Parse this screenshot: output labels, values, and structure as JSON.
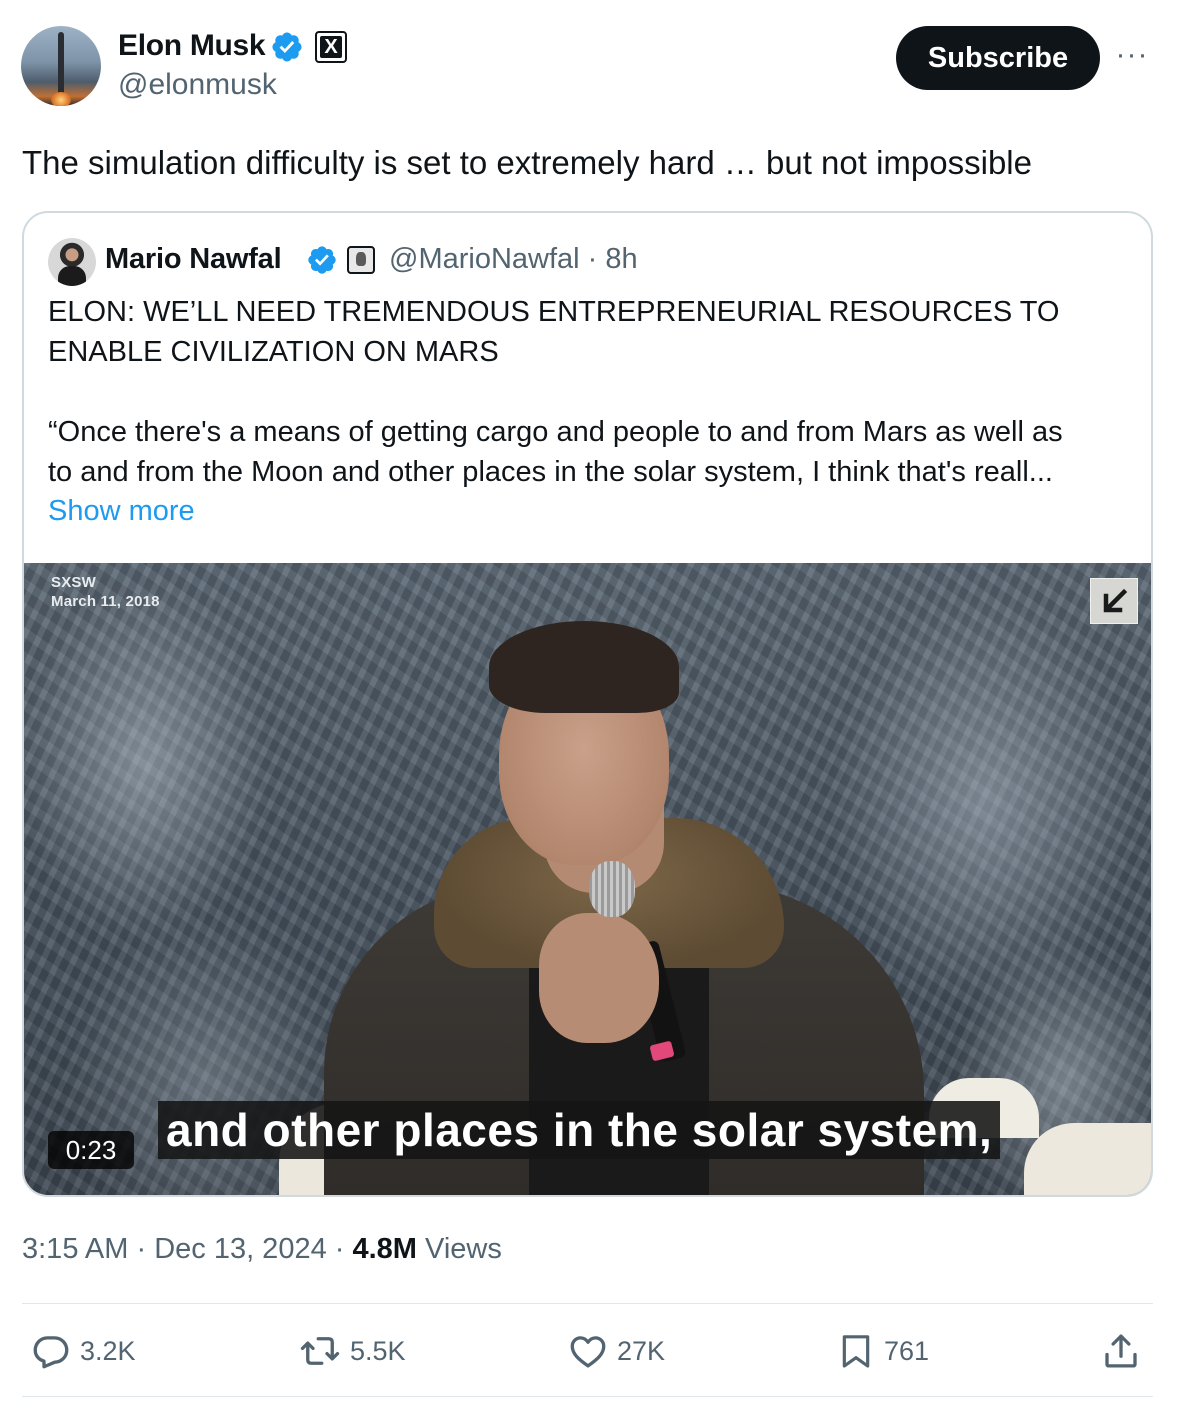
{
  "author": {
    "name": "Elon Musk",
    "handle": "@elonmusk",
    "affiliate_badge": "X"
  },
  "header": {
    "subscribe_label": "Subscribe",
    "more_label": "···"
  },
  "tweet": {
    "text": "The simulation difficulty is set to extremely hard … but not impossible"
  },
  "quote": {
    "name": "Mario Nawfal",
    "handle_time": "@MarioNawfal · 8h",
    "line1": "ELON: WE’LL NEED TREMENDOUS ENTREPRENEURIAL RESOURCES TO",
    "line2": "ENABLE CIVILIZATION ON MARS",
    "line3": "“Once there's a means of getting cargo and people to and from Mars as well as",
    "line4": "to and from the Moon and other places in the solar system, I think that's reall...",
    "show_more": "Show more",
    "video": {
      "event": "SXSW",
      "date": "March 11, 2018",
      "caption": "and other places in the solar system,",
      "duration": "0:23"
    }
  },
  "meta": {
    "time": "3:15 AM",
    "date": "Dec 13, 2024",
    "views_count": "4.8M",
    "views_label": "Views"
  },
  "actions": {
    "replies": "3.2K",
    "reposts": "5.5K",
    "likes": "27K",
    "bookmarks": "761"
  },
  "colors": {
    "accent": "#1d9bf0",
    "text": "#0f1419",
    "muted": "#536471",
    "border": "#cfd9de"
  },
  "icons": [
    "verified-badge-icon",
    "x-logo-icon",
    "more-icon",
    "expand-icon",
    "reply-icon",
    "repost-icon",
    "like-icon",
    "bookmark-icon",
    "share-icon"
  ]
}
